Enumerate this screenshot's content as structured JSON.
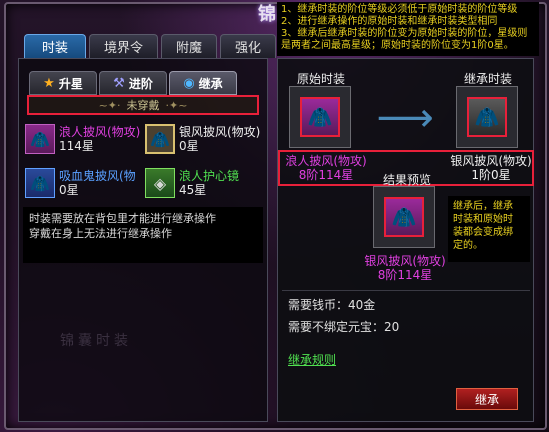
{
  "window": {
    "title_char": "锦"
  },
  "top_tabs": [
    "时装",
    "境界令",
    "附魔",
    "强化"
  ],
  "sub_tabs": [
    {
      "label": "升星",
      "icon": "star-icon"
    },
    {
      "label": "进阶",
      "icon": "hammer-icon"
    },
    {
      "label": "继承",
      "icon": "orb-icon"
    }
  ],
  "unequipped": "未穿戴",
  "items": [
    {
      "name": "浪人披风(物攻)",
      "sub": "114星"
    },
    {
      "name": "银风披风(物攻)",
      "sub": "0星"
    },
    {
      "name": "吸血鬼披风(物",
      "sub": "0星"
    },
    {
      "name": "浪人护心镜",
      "sub": "45星"
    }
  ],
  "note": {
    "line1": "时装需要放在背包里才能进行继承操作",
    "line2": "穿戴在身上无法进行继承操作"
  },
  "tooltip": {
    "line1": "1、继承时装的阶位等级必须低于原始时装的阶位等级",
    "line2": "2、进行继承操作的原始时装和继承时装类型相同",
    "line3": "3、继承后继承时装的阶位变为原始时装的阶位，星级则",
    "line4": "是两者之间最高星级；原始时装的阶位变为1阶0星。"
  },
  "original": {
    "label": "原始时装",
    "name": "浪人披风(物攻)",
    "stats": "8阶114星"
  },
  "inherit": {
    "label": "继承时装",
    "name": "银风披风(物攻)",
    "stats": "1阶0星"
  },
  "preview": {
    "label": "结果预览",
    "name": "银风披风(物攻)",
    "stats": "8阶114星"
  },
  "description": {
    "line1": "继承后，继承",
    "line2": "时装和原始时",
    "line3": "装都会变成绑",
    "line4": "定的。"
  },
  "costs": {
    "money": "需要钱币：40金",
    "gold": "需要不绑定元宝：20"
  },
  "rules_link": "继承规则",
  "inherit_button": "继承"
}
